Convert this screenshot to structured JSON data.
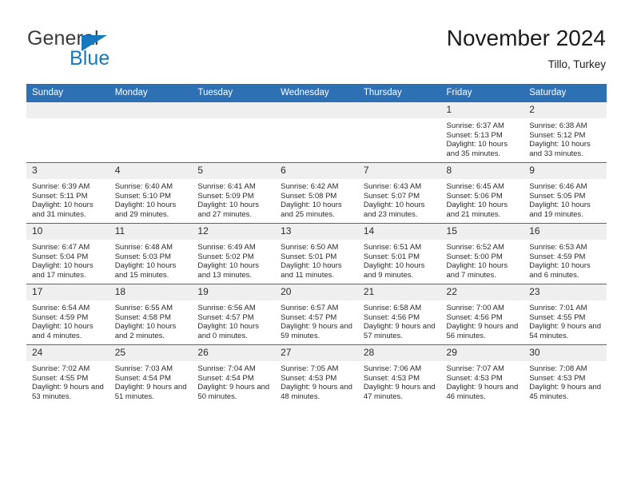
{
  "brand": {
    "name_part1": "General",
    "name_part2": "Blue"
  },
  "header": {
    "title": "November 2024",
    "subtitle": "Tillo, Turkey"
  },
  "colors": {
    "header_blue": "#2e70b4",
    "brand_blue": "#1878be",
    "daynum_bg": "#efefef",
    "text": "#2b2b2b"
  },
  "weekdays": [
    "Sunday",
    "Monday",
    "Tuesday",
    "Wednesday",
    "Thursday",
    "Friday",
    "Saturday"
  ],
  "labels": {
    "sunrise": "Sunrise:",
    "sunset": "Sunset:",
    "daylight": "Daylight:"
  },
  "weeks": [
    [
      {
        "empty": true
      },
      {
        "empty": true
      },
      {
        "empty": true
      },
      {
        "empty": true
      },
      {
        "empty": true
      },
      {
        "day": "1",
        "sunrise": "Sunrise: 6:37 AM",
        "sunset": "Sunset: 5:13 PM",
        "daylight": "Daylight: 10 hours and 35 minutes."
      },
      {
        "day": "2",
        "sunrise": "Sunrise: 6:38 AM",
        "sunset": "Sunset: 5:12 PM",
        "daylight": "Daylight: 10 hours and 33 minutes."
      }
    ],
    [
      {
        "day": "3",
        "sunrise": "Sunrise: 6:39 AM",
        "sunset": "Sunset: 5:11 PM",
        "daylight": "Daylight: 10 hours and 31 minutes."
      },
      {
        "day": "4",
        "sunrise": "Sunrise: 6:40 AM",
        "sunset": "Sunset: 5:10 PM",
        "daylight": "Daylight: 10 hours and 29 minutes."
      },
      {
        "day": "5",
        "sunrise": "Sunrise: 6:41 AM",
        "sunset": "Sunset: 5:09 PM",
        "daylight": "Daylight: 10 hours and 27 minutes."
      },
      {
        "day": "6",
        "sunrise": "Sunrise: 6:42 AM",
        "sunset": "Sunset: 5:08 PM",
        "daylight": "Daylight: 10 hours and 25 minutes."
      },
      {
        "day": "7",
        "sunrise": "Sunrise: 6:43 AM",
        "sunset": "Sunset: 5:07 PM",
        "daylight": "Daylight: 10 hours and 23 minutes."
      },
      {
        "day": "8",
        "sunrise": "Sunrise: 6:45 AM",
        "sunset": "Sunset: 5:06 PM",
        "daylight": "Daylight: 10 hours and 21 minutes."
      },
      {
        "day": "9",
        "sunrise": "Sunrise: 6:46 AM",
        "sunset": "Sunset: 5:05 PM",
        "daylight": "Daylight: 10 hours and 19 minutes."
      }
    ],
    [
      {
        "day": "10",
        "sunrise": "Sunrise: 6:47 AM",
        "sunset": "Sunset: 5:04 PM",
        "daylight": "Daylight: 10 hours and 17 minutes."
      },
      {
        "day": "11",
        "sunrise": "Sunrise: 6:48 AM",
        "sunset": "Sunset: 5:03 PM",
        "daylight": "Daylight: 10 hours and 15 minutes."
      },
      {
        "day": "12",
        "sunrise": "Sunrise: 6:49 AM",
        "sunset": "Sunset: 5:02 PM",
        "daylight": "Daylight: 10 hours and 13 minutes."
      },
      {
        "day": "13",
        "sunrise": "Sunrise: 6:50 AM",
        "sunset": "Sunset: 5:01 PM",
        "daylight": "Daylight: 10 hours and 11 minutes."
      },
      {
        "day": "14",
        "sunrise": "Sunrise: 6:51 AM",
        "sunset": "Sunset: 5:01 PM",
        "daylight": "Daylight: 10 hours and 9 minutes."
      },
      {
        "day": "15",
        "sunrise": "Sunrise: 6:52 AM",
        "sunset": "Sunset: 5:00 PM",
        "daylight": "Daylight: 10 hours and 7 minutes."
      },
      {
        "day": "16",
        "sunrise": "Sunrise: 6:53 AM",
        "sunset": "Sunset: 4:59 PM",
        "daylight": "Daylight: 10 hours and 6 minutes."
      }
    ],
    [
      {
        "day": "17",
        "sunrise": "Sunrise: 6:54 AM",
        "sunset": "Sunset: 4:59 PM",
        "daylight": "Daylight: 10 hours and 4 minutes."
      },
      {
        "day": "18",
        "sunrise": "Sunrise: 6:55 AM",
        "sunset": "Sunset: 4:58 PM",
        "daylight": "Daylight: 10 hours and 2 minutes."
      },
      {
        "day": "19",
        "sunrise": "Sunrise: 6:56 AM",
        "sunset": "Sunset: 4:57 PM",
        "daylight": "Daylight: 10 hours and 0 minutes."
      },
      {
        "day": "20",
        "sunrise": "Sunrise: 6:57 AM",
        "sunset": "Sunset: 4:57 PM",
        "daylight": "Daylight: 9 hours and 59 minutes."
      },
      {
        "day": "21",
        "sunrise": "Sunrise: 6:58 AM",
        "sunset": "Sunset: 4:56 PM",
        "daylight": "Daylight: 9 hours and 57 minutes."
      },
      {
        "day": "22",
        "sunrise": "Sunrise: 7:00 AM",
        "sunset": "Sunset: 4:56 PM",
        "daylight": "Daylight: 9 hours and 56 minutes."
      },
      {
        "day": "23",
        "sunrise": "Sunrise: 7:01 AM",
        "sunset": "Sunset: 4:55 PM",
        "daylight": "Daylight: 9 hours and 54 minutes."
      }
    ],
    [
      {
        "day": "24",
        "sunrise": "Sunrise: 7:02 AM",
        "sunset": "Sunset: 4:55 PM",
        "daylight": "Daylight: 9 hours and 53 minutes."
      },
      {
        "day": "25",
        "sunrise": "Sunrise: 7:03 AM",
        "sunset": "Sunset: 4:54 PM",
        "daylight": "Daylight: 9 hours and 51 minutes."
      },
      {
        "day": "26",
        "sunrise": "Sunrise: 7:04 AM",
        "sunset": "Sunset: 4:54 PM",
        "daylight": "Daylight: 9 hours and 50 minutes."
      },
      {
        "day": "27",
        "sunrise": "Sunrise: 7:05 AM",
        "sunset": "Sunset: 4:53 PM",
        "daylight": "Daylight: 9 hours and 48 minutes."
      },
      {
        "day": "28",
        "sunrise": "Sunrise: 7:06 AM",
        "sunset": "Sunset: 4:53 PM",
        "daylight": "Daylight: 9 hours and 47 minutes."
      },
      {
        "day": "29",
        "sunrise": "Sunrise: 7:07 AM",
        "sunset": "Sunset: 4:53 PM",
        "daylight": "Daylight: 9 hours and 46 minutes."
      },
      {
        "day": "30",
        "sunrise": "Sunrise: 7:08 AM",
        "sunset": "Sunset: 4:53 PM",
        "daylight": "Daylight: 9 hours and 45 minutes."
      }
    ]
  ]
}
